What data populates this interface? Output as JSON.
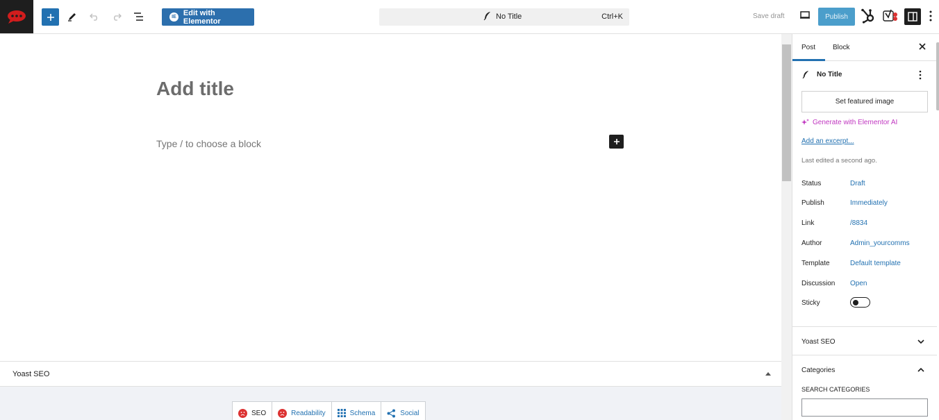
{
  "topbar": {
    "edit_with_elementor": "Edit with Elementor",
    "doc_title": "No Title",
    "shortcut": "Ctrl+K",
    "save_draft": "Save draft",
    "publish": "Publish",
    "colors": {
      "accent": "#2271b1",
      "logo_bg": "#1e1e1e",
      "logo_red": "#d11d1d"
    }
  },
  "editor": {
    "title_placeholder": "Add title",
    "block_placeholder": "Type / to choose a block"
  },
  "metabox": {
    "label": "Yoast SEO",
    "tabs": [
      {
        "label": "SEO",
        "icon": "sad-face-icon"
      },
      {
        "label": "Readability",
        "icon": "sad-face-icon"
      },
      {
        "label": "Schema",
        "icon": "grid-icon"
      },
      {
        "label": "Social",
        "icon": "share-icon"
      }
    ]
  },
  "sidebar": {
    "tabs": [
      "Post",
      "Block"
    ],
    "post_title": "No Title",
    "featured_image": "Set featured image",
    "generate_ai": "Generate with Elementor AI",
    "add_excerpt": "Add an excerpt...",
    "last_edited": "Last edited a second ago.",
    "rows": [
      {
        "label": "Status",
        "value": "Draft"
      },
      {
        "label": "Publish",
        "value": "Immediately"
      },
      {
        "label": "Link",
        "value": "/8834"
      },
      {
        "label": "Author",
        "value": "Admin_yourcomms"
      },
      {
        "label": "Template",
        "value": "Default template"
      },
      {
        "label": "Discussion",
        "value": "Open"
      }
    ],
    "sticky_label": "Sticky",
    "sticky_on": false,
    "yoast_panel": "Yoast SEO",
    "categories_panel": "Categories",
    "search_categories": "SEARCH CATEGORIES"
  }
}
